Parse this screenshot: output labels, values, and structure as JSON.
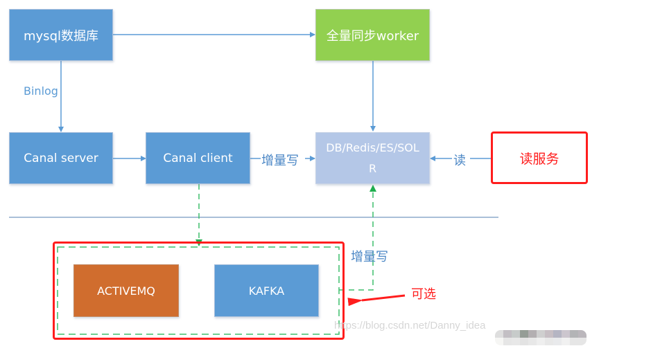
{
  "nodes": {
    "mysql": {
      "label": "mysql数据库",
      "color": "#5b9bd5"
    },
    "full_sync": {
      "label": "全量同步worker",
      "color": "#92d050"
    },
    "canal_server": {
      "label": "Canal server",
      "color": "#5b9bd5"
    },
    "canal_client": {
      "label": "Canal client",
      "color": "#5b9bd5"
    },
    "storage": {
      "label_line1": "DB/Redis/ES/SOL",
      "label_line2": "R",
      "color": "#b4c7e7"
    },
    "read_service": {
      "label": "读服务",
      "color": "#ff1d1d"
    },
    "activemq": {
      "label": "ACTIVEMQ",
      "color": "#d06d2e"
    },
    "kafka": {
      "label": "KAFKA",
      "color": "#5b9bd5"
    }
  },
  "edge_labels": {
    "binlog": "Binlog",
    "incremental_write": "增量写",
    "read": "读",
    "incremental_write_mq": "增量写",
    "optional": "可选"
  },
  "colors": {
    "connector": "#5b9bd5",
    "dashed": "#3dbd6b",
    "highlight": "#ff1d1d",
    "divider": "#a9bfd8"
  },
  "watermark": "https://blog.csdn.net/Danny_idea"
}
